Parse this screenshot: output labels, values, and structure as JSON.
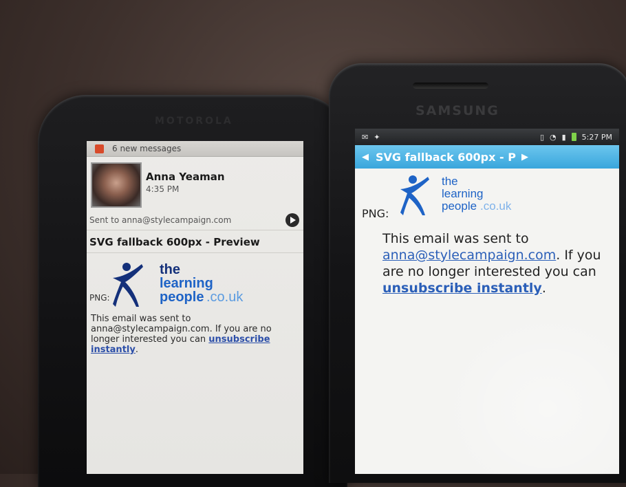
{
  "left_phone": {
    "brand": "MOTOROLA",
    "notification": "6 new messages",
    "sender_name": "Anna Yeaman",
    "time": "4:35 PM",
    "sent_to": "Sent to anna@stylecampaign.com",
    "subject": "SVG fallback 600px - Preview",
    "png_label": "PNG:",
    "body_text": "This email was sent to anna@stylecampaign.com. If you are no longer interested you can ",
    "link_text": "unsubscribe instantly",
    "trailing": "."
  },
  "right_phone": {
    "brand": "SAMSUNG",
    "status_time": "5:27 PM",
    "title": "SVG fallback 600px - P",
    "png_label": "PNG:",
    "body_prefix": "This email was sent to",
    "email_link": "anna@stylecampaign.com",
    "body_middle": ". If you are no longer interested you can",
    "link_text": "unsubscribe instantly",
    "trailing": "."
  },
  "logo": {
    "line1": "the",
    "line2": "learning",
    "line3": "people",
    "suffix": ".co.uk",
    "colors": {
      "navy": "#14307a",
      "blue": "#1e63c6",
      "light_blue": "#5b9be0"
    }
  },
  "colors": {
    "accent_title_bar": "#39a6dc",
    "link": "#2b4ea8"
  }
}
